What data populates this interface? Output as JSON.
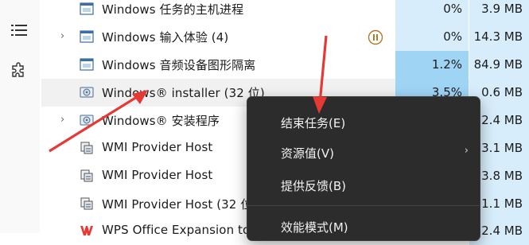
{
  "nav": [
    {
      "name": "hamburger-menu-icon"
    },
    {
      "name": "puzzle-icon"
    }
  ],
  "rows": [
    {
      "name": "Windows 任务的主机进程",
      "cpu": "0%",
      "mem": "3.9 MB",
      "expandable": false,
      "icon": "window-icon",
      "cpu_heat": "light",
      "mem_heat": "light"
    },
    {
      "name": "Windows 输入体验 (4)",
      "cpu": "0%",
      "mem": "14.3 MB",
      "expandable": true,
      "icon": "window-icon",
      "status": "paused-icon",
      "cpu_heat": "light",
      "mem_heat": "light"
    },
    {
      "name": "Windows 音频设备图形隔离",
      "cpu": "1.2%",
      "mem": "84.9 MB",
      "expandable": false,
      "icon": "window-icon",
      "cpu_heat": "medium",
      "mem_heat": "light"
    },
    {
      "name": "Windows® installer (32 位)",
      "cpu": "3.5%",
      "mem": "0.6 MB",
      "expandable": false,
      "icon": "installer-icon",
      "cpu_heat": "medium",
      "mem_heat": "light",
      "hover": true
    },
    {
      "name": "Windows® 安装程序",
      "cpu": "",
      "mem": "2.4 MB",
      "expandable": true,
      "icon": "installer-icon",
      "mem_heat": "light"
    },
    {
      "name": "WMI Provider Host",
      "cpu": "",
      "mem": "3.1 MB",
      "expandable": false,
      "icon": "wmi-icon",
      "mem_heat": "light"
    },
    {
      "name": "WMI Provider Host",
      "cpu": "",
      "mem": "13.8 MB",
      "expandable": false,
      "icon": "wmi-icon",
      "mem_heat": "light"
    },
    {
      "name": "WMI Provider Host (32 位",
      "cpu": "",
      "mem": "1.1 MB",
      "expandable": false,
      "icon": "wmi-icon",
      "mem_heat": "light"
    },
    {
      "name": "WPS Office Expansion too",
      "cpu": "",
      "mem": "2.4 MB",
      "expandable": false,
      "icon": "wps-icon",
      "mem_heat": "light"
    }
  ],
  "colors": {
    "heat_light": "#d8edfb",
    "heat_medium": "#9fd4f5",
    "arrow": "#e53935",
    "paused": "#b07a2a"
  },
  "context_menu": {
    "items": [
      {
        "label": "结束任务(E)",
        "shortcut": "E"
      },
      {
        "label": "资源值(V)",
        "submenu": "chevron-right-icon"
      },
      {
        "label": "提供反馈(B)"
      },
      {
        "label": "效能模式(M)"
      }
    ],
    "submenu_glyph": "›"
  }
}
